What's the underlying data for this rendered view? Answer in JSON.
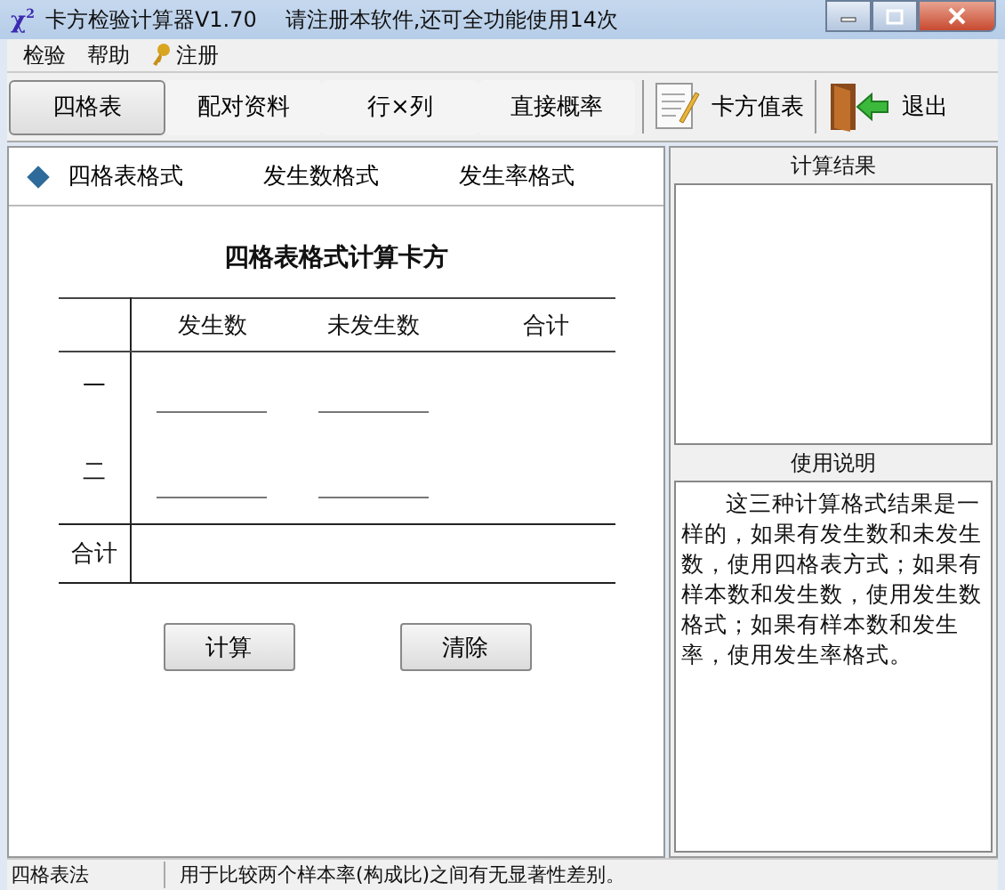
{
  "window": {
    "logo": "χ$^{2}$",
    "title": "卡方检验计算器V1.70",
    "notice": "请注册本软件,还可全功能使用14次"
  },
  "menu": [
    {
      "label": "检验",
      "kind": "plain"
    },
    {
      "label": "帮助",
      "kind": "plain"
    },
    {
      "label": "注册",
      "kind": "key"
    }
  ],
  "tabs": [
    {
      "label": "四格表",
      "selected": true
    },
    {
      "label": "配对资料",
      "selected": false
    },
    {
      "label": "行×列",
      "selected": false
    },
    {
      "label": "直接概率",
      "selected": false
    }
  ],
  "tools": [
    {
      "label": "卡方值表",
      "kind": "table"
    },
    {
      "label": "退出",
      "kind": "exit"
    }
  ],
  "formats": [
    {
      "label": "四格表格式",
      "selected": true
    },
    {
      "label": "发生数格式",
      "selected": false
    },
    {
      "label": "发生率格式",
      "selected": false
    }
  ],
  "form": {
    "title": "四格表格式计算卡方",
    "columns": [
      {
        "label": "发生数",
        "kind": "entry"
      },
      {
        "label": "未发生数",
        "kind": "entry"
      },
      {
        "label": "合计",
        "kind": "sum"
      }
    ],
    "rows": [
      {
        "label": "一"
      },
      {
        "label": "二"
      }
    ],
    "total_label": "合计",
    "buttons": [
      "计算",
      "清除"
    ]
  },
  "result": {
    "title": "计算结果"
  },
  "help": {
    "title": "使用说明",
    "text": "这三种计算格式结果是一样的，如果有发生数和未发生数，使用四格表方式；如果有样本数和发生数，使用发生数格式；如果有样本数和发生率，使用发生率格式。"
  },
  "status_bar": [
    "四格表法",
    "用于比较两个样本率(构成比)之间有无显著性差别。"
  ]
}
